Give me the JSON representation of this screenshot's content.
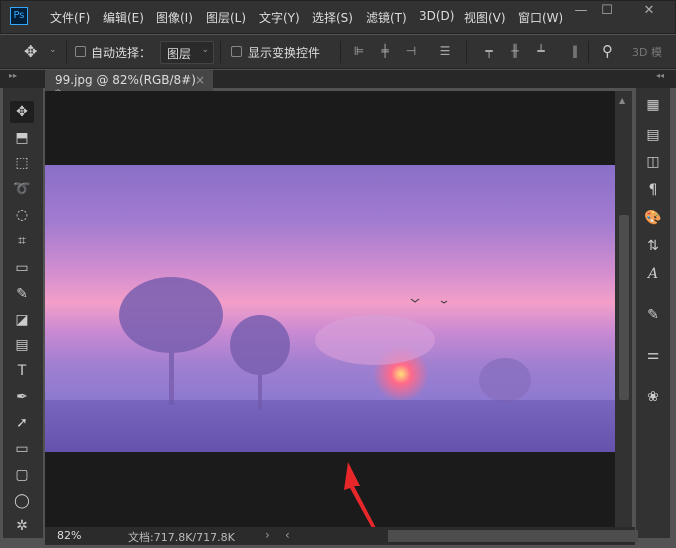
{
  "app": {
    "logo": "Ps"
  },
  "menu": [
    "文件(F)",
    "编辑(E)",
    "图像(I)",
    "图层(L)",
    "文字(Y)",
    "选择(S)",
    "滤镜(T)",
    "3D(D)",
    "视图(V)",
    "窗口(W)"
  ],
  "window_controls": {
    "minimize": "—",
    "maximize": "☐",
    "close": "✕"
  },
  "options": {
    "auto_select_label": "自动选择：",
    "layer_select": "图层",
    "show_transform_label": "显示变换控件",
    "mode_3d": "3D 模"
  },
  "document_tab": {
    "title": "99.jpg @ 82%(RGB/8#) *",
    "close": "×"
  },
  "status": {
    "zoom": "82%",
    "doc_info": "文档:717.8K/717.8K"
  },
  "colors": {
    "accent": "#31a8ff",
    "arrow": "#e8272b"
  }
}
